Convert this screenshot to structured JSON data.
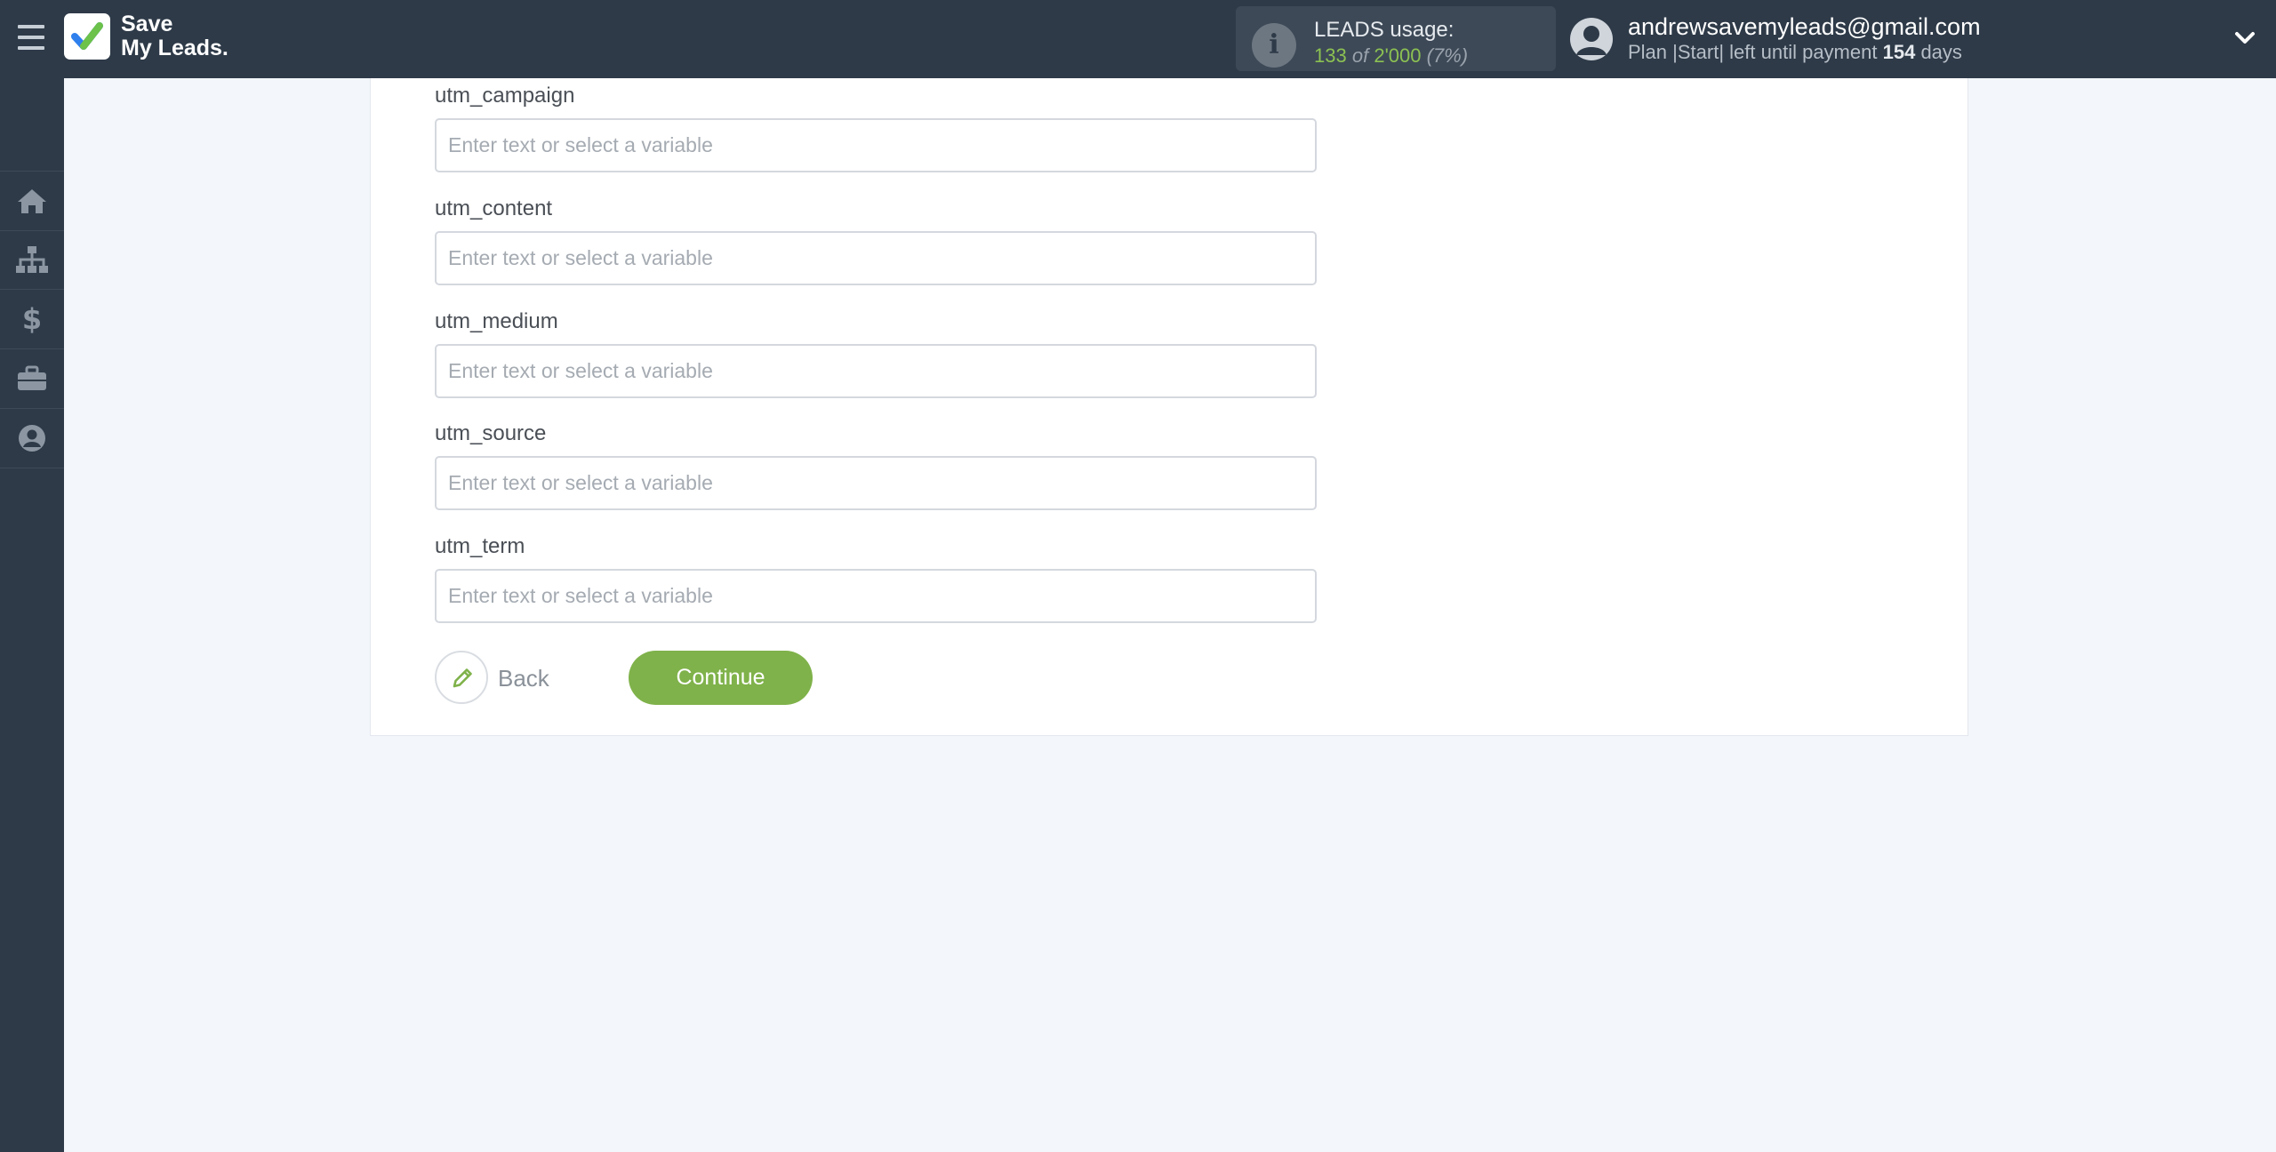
{
  "app": {
    "logo_line1": "Save",
    "logo_line2": "My Leads."
  },
  "usage": {
    "label": "LEADS usage:",
    "used": "133",
    "of": "of",
    "limit": "2'000",
    "percent": "(7%)"
  },
  "account": {
    "email": "andrewsavemyleads@gmail.com",
    "plan_prefix": "Plan |Start| left until payment",
    "days_value": "154",
    "days_suffix": "days"
  },
  "sidebar": {
    "items": [
      "home-icon",
      "sitemap-icon",
      "dollar-icon",
      "briefcase-icon",
      "user-circle-icon"
    ]
  },
  "fields": [
    {
      "label": "utm_campaign",
      "placeholder": "Enter text or select a variable",
      "value": ""
    },
    {
      "label": "utm_content",
      "placeholder": "Enter text or select a variable",
      "value": ""
    },
    {
      "label": "utm_medium",
      "placeholder": "Enter text or select a variable",
      "value": ""
    },
    {
      "label": "utm_source",
      "placeholder": "Enter text or select a variable",
      "value": ""
    },
    {
      "label": "utm_term",
      "placeholder": "Enter text or select a variable",
      "value": ""
    }
  ],
  "actions": {
    "back_label": "Back",
    "continue_label": "Continue"
  },
  "colors": {
    "topbar": "#2e3a48",
    "accent_green": "#7fb24a",
    "background": "#f3f6fa"
  }
}
